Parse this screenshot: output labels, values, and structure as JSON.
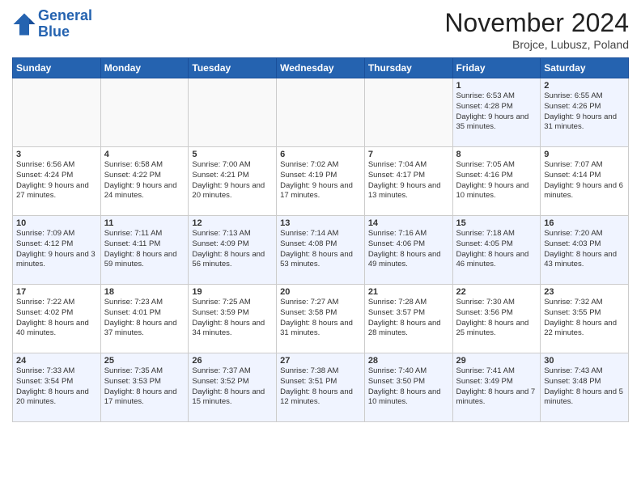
{
  "logo": {
    "line1": "General",
    "line2": "Blue"
  },
  "title": "November 2024",
  "location": "Brojce, Lubusz, Poland",
  "days_of_week": [
    "Sunday",
    "Monday",
    "Tuesday",
    "Wednesday",
    "Thursday",
    "Friday",
    "Saturday"
  ],
  "weeks": [
    [
      {
        "day": "",
        "info": ""
      },
      {
        "day": "",
        "info": ""
      },
      {
        "day": "",
        "info": ""
      },
      {
        "day": "",
        "info": ""
      },
      {
        "day": "",
        "info": ""
      },
      {
        "day": "1",
        "info": "Sunrise: 6:53 AM\nSunset: 4:28 PM\nDaylight: 9 hours and 35 minutes."
      },
      {
        "day": "2",
        "info": "Sunrise: 6:55 AM\nSunset: 4:26 PM\nDaylight: 9 hours and 31 minutes."
      }
    ],
    [
      {
        "day": "3",
        "info": "Sunrise: 6:56 AM\nSunset: 4:24 PM\nDaylight: 9 hours and 27 minutes."
      },
      {
        "day": "4",
        "info": "Sunrise: 6:58 AM\nSunset: 4:22 PM\nDaylight: 9 hours and 24 minutes."
      },
      {
        "day": "5",
        "info": "Sunrise: 7:00 AM\nSunset: 4:21 PM\nDaylight: 9 hours and 20 minutes."
      },
      {
        "day": "6",
        "info": "Sunrise: 7:02 AM\nSunset: 4:19 PM\nDaylight: 9 hours and 17 minutes."
      },
      {
        "day": "7",
        "info": "Sunrise: 7:04 AM\nSunset: 4:17 PM\nDaylight: 9 hours and 13 minutes."
      },
      {
        "day": "8",
        "info": "Sunrise: 7:05 AM\nSunset: 4:16 PM\nDaylight: 9 hours and 10 minutes."
      },
      {
        "day": "9",
        "info": "Sunrise: 7:07 AM\nSunset: 4:14 PM\nDaylight: 9 hours and 6 minutes."
      }
    ],
    [
      {
        "day": "10",
        "info": "Sunrise: 7:09 AM\nSunset: 4:12 PM\nDaylight: 9 hours and 3 minutes."
      },
      {
        "day": "11",
        "info": "Sunrise: 7:11 AM\nSunset: 4:11 PM\nDaylight: 8 hours and 59 minutes."
      },
      {
        "day": "12",
        "info": "Sunrise: 7:13 AM\nSunset: 4:09 PM\nDaylight: 8 hours and 56 minutes."
      },
      {
        "day": "13",
        "info": "Sunrise: 7:14 AM\nSunset: 4:08 PM\nDaylight: 8 hours and 53 minutes."
      },
      {
        "day": "14",
        "info": "Sunrise: 7:16 AM\nSunset: 4:06 PM\nDaylight: 8 hours and 49 minutes."
      },
      {
        "day": "15",
        "info": "Sunrise: 7:18 AM\nSunset: 4:05 PM\nDaylight: 8 hours and 46 minutes."
      },
      {
        "day": "16",
        "info": "Sunrise: 7:20 AM\nSunset: 4:03 PM\nDaylight: 8 hours and 43 minutes."
      }
    ],
    [
      {
        "day": "17",
        "info": "Sunrise: 7:22 AM\nSunset: 4:02 PM\nDaylight: 8 hours and 40 minutes."
      },
      {
        "day": "18",
        "info": "Sunrise: 7:23 AM\nSunset: 4:01 PM\nDaylight: 8 hours and 37 minutes."
      },
      {
        "day": "19",
        "info": "Sunrise: 7:25 AM\nSunset: 3:59 PM\nDaylight: 8 hours and 34 minutes."
      },
      {
        "day": "20",
        "info": "Sunrise: 7:27 AM\nSunset: 3:58 PM\nDaylight: 8 hours and 31 minutes."
      },
      {
        "day": "21",
        "info": "Sunrise: 7:28 AM\nSunset: 3:57 PM\nDaylight: 8 hours and 28 minutes."
      },
      {
        "day": "22",
        "info": "Sunrise: 7:30 AM\nSunset: 3:56 PM\nDaylight: 8 hours and 25 minutes."
      },
      {
        "day": "23",
        "info": "Sunrise: 7:32 AM\nSunset: 3:55 PM\nDaylight: 8 hours and 22 minutes."
      }
    ],
    [
      {
        "day": "24",
        "info": "Sunrise: 7:33 AM\nSunset: 3:54 PM\nDaylight: 8 hours and 20 minutes."
      },
      {
        "day": "25",
        "info": "Sunrise: 7:35 AM\nSunset: 3:53 PM\nDaylight: 8 hours and 17 minutes."
      },
      {
        "day": "26",
        "info": "Sunrise: 7:37 AM\nSunset: 3:52 PM\nDaylight: 8 hours and 15 minutes."
      },
      {
        "day": "27",
        "info": "Sunrise: 7:38 AM\nSunset: 3:51 PM\nDaylight: 8 hours and 12 minutes."
      },
      {
        "day": "28",
        "info": "Sunrise: 7:40 AM\nSunset: 3:50 PM\nDaylight: 8 hours and 10 minutes."
      },
      {
        "day": "29",
        "info": "Sunrise: 7:41 AM\nSunset: 3:49 PM\nDaylight: 8 hours and 7 minutes."
      },
      {
        "day": "30",
        "info": "Sunrise: 7:43 AM\nSunset: 3:48 PM\nDaylight: 8 hours and 5 minutes."
      }
    ]
  ]
}
